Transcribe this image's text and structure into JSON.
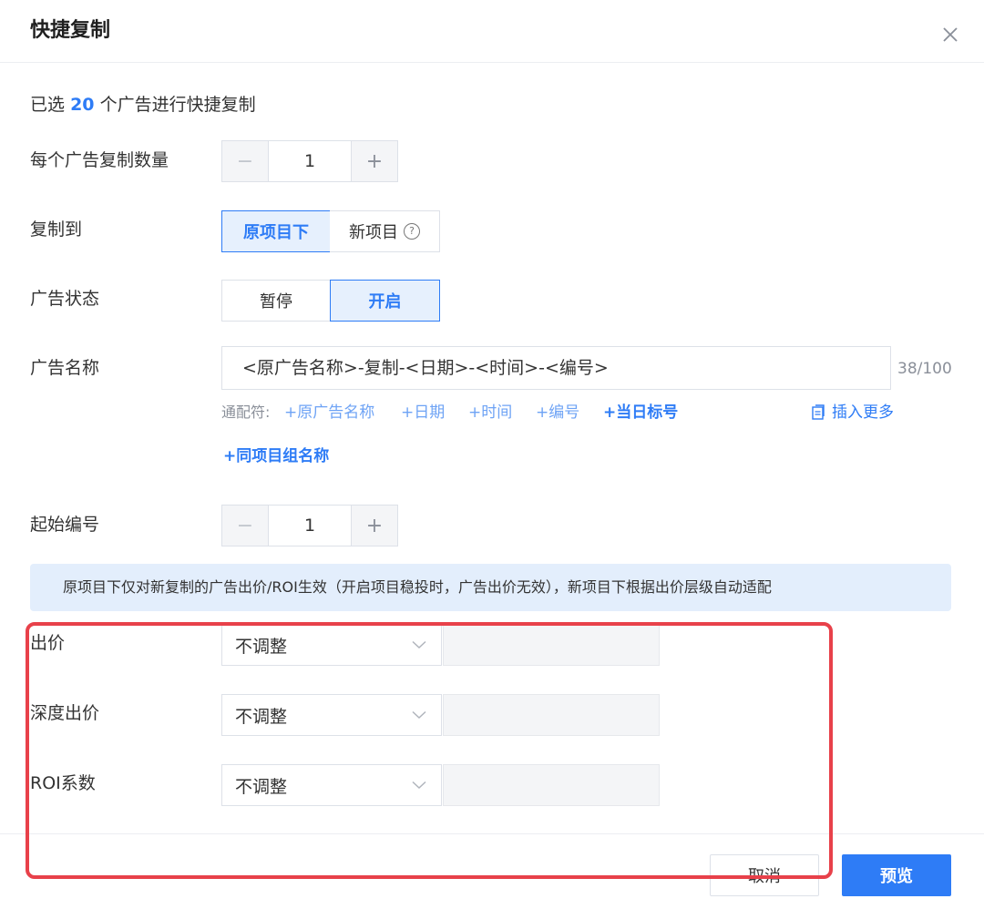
{
  "dialog": {
    "title": "快捷复制"
  },
  "summary": {
    "prefix": "已选",
    "count": "20",
    "suffix": "个广告进行快捷复制"
  },
  "copy_count": {
    "label": "每个广告复制数量",
    "minus": "−",
    "value": "1",
    "plus": "+"
  },
  "copy_to": {
    "label": "复制到",
    "options": [
      "原项目下",
      "新项目"
    ],
    "selected": "原项目下",
    "help": "?"
  },
  "ad_status": {
    "label": "广告状态",
    "options": [
      "暂停",
      "开启"
    ],
    "selected": "开启"
  },
  "ad_name": {
    "label": "广告名称",
    "value": "<原广告名称>-复制-<日期>-<时间>-<编号>",
    "counter": "38/100",
    "wildcard_label": "通配符:",
    "wildcards": [
      "+原广告名称",
      "+日期",
      "+时间",
      "+编号",
      "+当日标号",
      "+同项目组名称"
    ],
    "insert_more": "插入更多"
  },
  "start_number": {
    "label": "起始编号",
    "minus": "−",
    "value": "1",
    "plus": "+"
  },
  "notice": "原项目下仅对新复制的广告出价/ROI生效（开启项目稳投时，广告出价无效），新项目下根据出价层级自动适配",
  "bid": {
    "label": "出价",
    "select": "不调整"
  },
  "deep_bid": {
    "label": "深度出价",
    "select": "不调整"
  },
  "roi": {
    "label": "ROI系数",
    "select": "不调整"
  },
  "footer": {
    "cancel": "取消",
    "preview": "预览"
  },
  "colors": {
    "accent": "#2e7cf6",
    "highlight": "#e8414a",
    "notice_bg": "#e3eefc"
  }
}
